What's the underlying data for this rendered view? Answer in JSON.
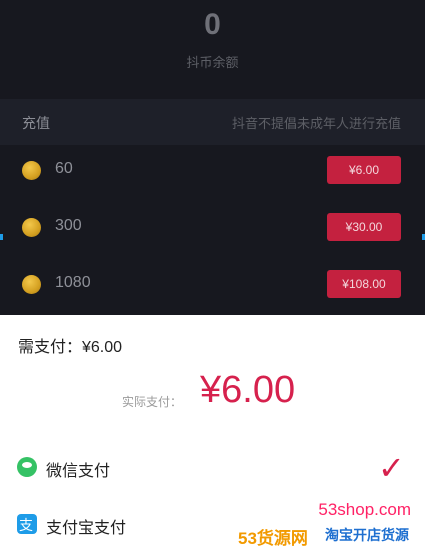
{
  "balance": {
    "value": "0",
    "label": "抖币余额"
  },
  "recharge": {
    "title": "充值",
    "notice": "抖音不提倡未成年人进行充值",
    "options": [
      {
        "amount": "60",
        "price": "¥6.00"
      },
      {
        "amount": "300",
        "price": "¥30.00"
      },
      {
        "amount": "1080",
        "price": "¥108.00"
      }
    ]
  },
  "payment": {
    "need": "需支付：¥6.00",
    "actual_label": "实际支付：",
    "actual_value": "¥6.00",
    "methods": [
      {
        "label": "微信支付",
        "icon": "wechat-icon",
        "selected": true
      },
      {
        "label": "支付宝支付",
        "icon": "alipay-icon",
        "selected": false
      }
    ],
    "check_glyph": "✓"
  },
  "watermark": {
    "site": "53shop.com",
    "brand": "53货源网",
    "tagline": "淘宝开店货源"
  },
  "colors": {
    "accent": "#d6214d",
    "button": "#c4213f",
    "dark_bg": "#17181f",
    "coin": "#d4a021"
  }
}
